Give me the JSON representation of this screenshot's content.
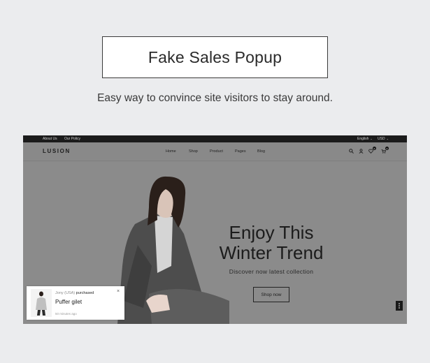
{
  "header": {
    "title": "Fake Sales Popup",
    "subtitle": "Easy way to convince site visitors to stay around."
  },
  "topbar": {
    "links": [
      "About Us",
      "Our Policy"
    ],
    "language": "English",
    "currency": "USD"
  },
  "nav": {
    "logo": "LUSION",
    "menu": [
      "Home",
      "Shop",
      "Product",
      "Pages",
      "Blog"
    ],
    "icons": [
      "search-icon",
      "user-icon",
      "wishlist-icon",
      "cart-icon"
    ],
    "wishlist_count": "0",
    "cart_count": "0"
  },
  "hero": {
    "heading_line1": "Enjoy This",
    "heading_line2": "Winter Trend",
    "subheading": "Discover now latest collection",
    "cta": "Shop now"
  },
  "popup": {
    "buyer": "Jony (USA)",
    "action": "purchased",
    "product": "Puffer gilet",
    "time": "50 minutes ago"
  },
  "colors": {
    "page_bg": "#ebecee",
    "hero_bg": "#8b8b8b",
    "topbar_bg": "#1b1b1b",
    "popup_bg": "#ffffff"
  }
}
